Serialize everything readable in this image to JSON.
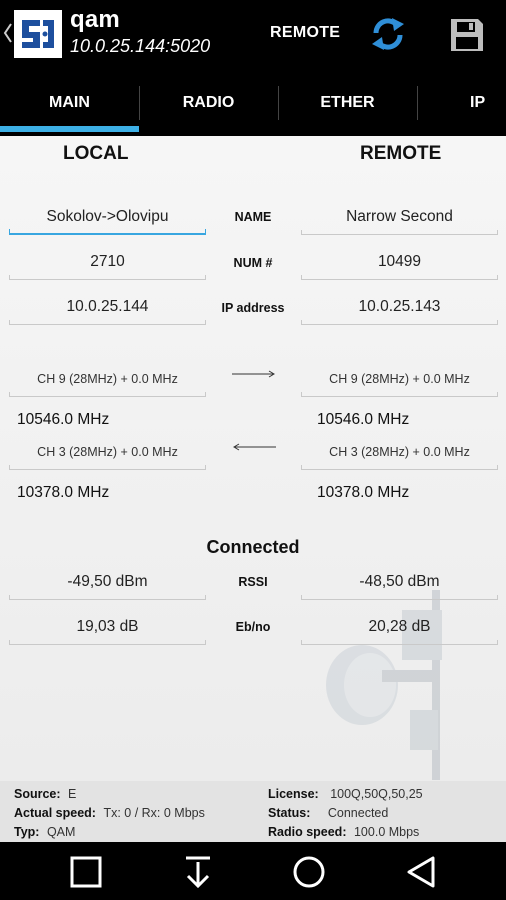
{
  "header": {
    "title": "qam",
    "address": "10.0.25.144:5020",
    "remote_label": "REMOTE",
    "sync_icon": "sync-icon",
    "save_icon": "save-icon",
    "logo_icon": "app-logo-icon"
  },
  "tabs": [
    {
      "label": "MAIN",
      "active": true
    },
    {
      "label": "RADIO"
    },
    {
      "label": "ETHER"
    },
    {
      "label": "IP"
    }
  ],
  "columns": {
    "local": "LOCAL",
    "remote": "REMOTE"
  },
  "local": {
    "name": "Sokolov->Olovipu",
    "num": "2710",
    "ip": "10.0.25.144",
    "tx_channel": "CH 9 (28MHz) + 0.0 MHz",
    "tx_freq": "10546.0 MHz",
    "rx_channel": "CH 3 (28MHz) + 0.0 MHz",
    "rx_freq": "10378.0 MHz",
    "rssi": "-49,50 dBm",
    "ebno": "19,03 dB"
  },
  "remote": {
    "name": "Narrow Second",
    "num": "10499",
    "ip": "10.0.25.143",
    "tx_channel": "CH 9 (28MHz) + 0.0 MHz",
    "tx_freq": "10546.0 MHz",
    "rx_channel": "CH 3 (28MHz) + 0.0 MHz",
    "rx_freq": "10378.0 MHz",
    "rssi": "-48,50 dBm",
    "ebno": "20,28 dB"
  },
  "labels": {
    "name": "NAME",
    "num": "NUM #",
    "ip": "IP address",
    "rssi": "RSSI",
    "ebno": "Eb/no"
  },
  "status_text": "Connected",
  "info": {
    "source_key": "Source:",
    "source_val": "E",
    "speed_key": "Actual speed:",
    "speed_val": "Tx: 0 / Rx: 0 Mbps",
    "typ_key": "Typ:",
    "typ_val": "QAM",
    "license_key": "License:",
    "license_val": "100Q,50Q,50,25",
    "status_key": "Status:",
    "status_val": "Connected",
    "radio_speed_key": "Radio speed:",
    "radio_speed_val": "100.0 Mbps"
  },
  "colors": {
    "accent": "#3db0e6",
    "bar_bg": "#000000",
    "logo_blue": "#1d4f9e"
  },
  "nav": [
    "recents-icon",
    "download-icon",
    "home-icon",
    "back-icon"
  ]
}
